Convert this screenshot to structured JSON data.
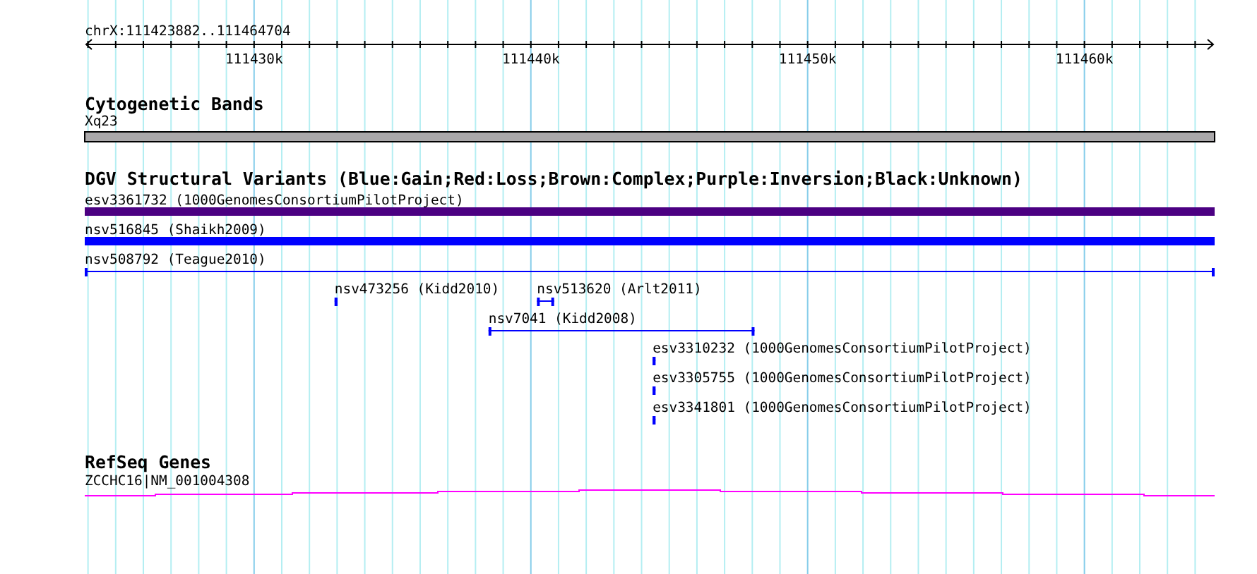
{
  "ruler": {
    "label": "chrX:111423882..111464704",
    "ticks": [
      {
        "label": "111430k"
      },
      {
        "label": "111440k"
      },
      {
        "label": "111450k"
      },
      {
        "label": "111460k"
      }
    ]
  },
  "cytogenetic_bands": {
    "title": "Cytogenetic Bands",
    "bands": [
      {
        "label": "Xq23"
      }
    ]
  },
  "dgv_track": {
    "title": "DGV Structural Variants (Blue:Gain;Red:Loss;Brown:Complex;Purple:Inversion;Black:Unknown)",
    "features": [
      {
        "label": "esv3361732 (1000GenomesConsortiumPilotProject)",
        "kind": "bar",
        "color": "#4b0082"
      },
      {
        "label": "nsv516845 (Shaikh2009)",
        "kind": "bar",
        "color": "#0000ff"
      },
      {
        "label": "nsv508792 (Teague2010)",
        "kind": "span",
        "color": "#0000ff"
      },
      {
        "label": "nsv473256 (Kidd2010)",
        "kind": "span",
        "color": "#0000ff"
      },
      {
        "label": "nsv513620 (Arlt2011)",
        "kind": "span",
        "color": "#0000ff"
      },
      {
        "label": "nsv7041 (Kidd2008)",
        "kind": "span",
        "color": "#0000ff"
      },
      {
        "label": "esv3310232 (1000GenomesConsortiumPilotProject)",
        "kind": "span",
        "color": "#0000ff"
      },
      {
        "label": "esv3305755 (1000GenomesConsortiumPilotProject)",
        "kind": "span",
        "color": "#0000ff"
      },
      {
        "label": "esv3341801 (1000GenomesConsortiumPilotProject)",
        "kind": "span",
        "color": "#0000ff"
      }
    ]
  },
  "refseq_genes": {
    "title": "RefSeq Genes",
    "genes": [
      {
        "label": "ZCCHC16|NM_001004308"
      }
    ]
  }
}
